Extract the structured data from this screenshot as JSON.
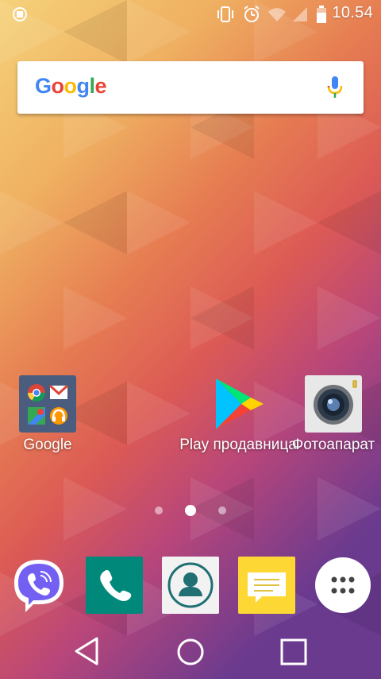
{
  "status_bar": {
    "time": "10.54",
    "icons": [
      "sync-icon",
      "vibrate-icon",
      "alarm-icon",
      "wifi-icon",
      "signal-icon",
      "battery-icon"
    ]
  },
  "search_widget": {
    "logo_text": "Google",
    "logo_colors": [
      "#4285F4",
      "#EA4335",
      "#FBBC05",
      "#4285F4",
      "#34A853",
      "#EA4335"
    ],
    "mic_icon": "mic-icon"
  },
  "home_apps": [
    {
      "label": "Google",
      "icon": "google-folder-icon"
    },
    {
      "label": "Play продавница",
      "icon": "play-store-icon"
    },
    {
      "label": "Фотоапарат",
      "icon": "camera-icon"
    }
  ],
  "page_indicator": {
    "pages": 3,
    "current": 2
  },
  "dock": [
    "viber-icon",
    "phone-icon",
    "contacts-icon",
    "messages-icon",
    "app-drawer-icon"
  ],
  "nav_bar": [
    "back-icon",
    "home-icon",
    "recents-icon"
  ],
  "colors": {
    "phone": "#00897B",
    "viber": "#7360F2",
    "messages": "#FDD835"
  }
}
